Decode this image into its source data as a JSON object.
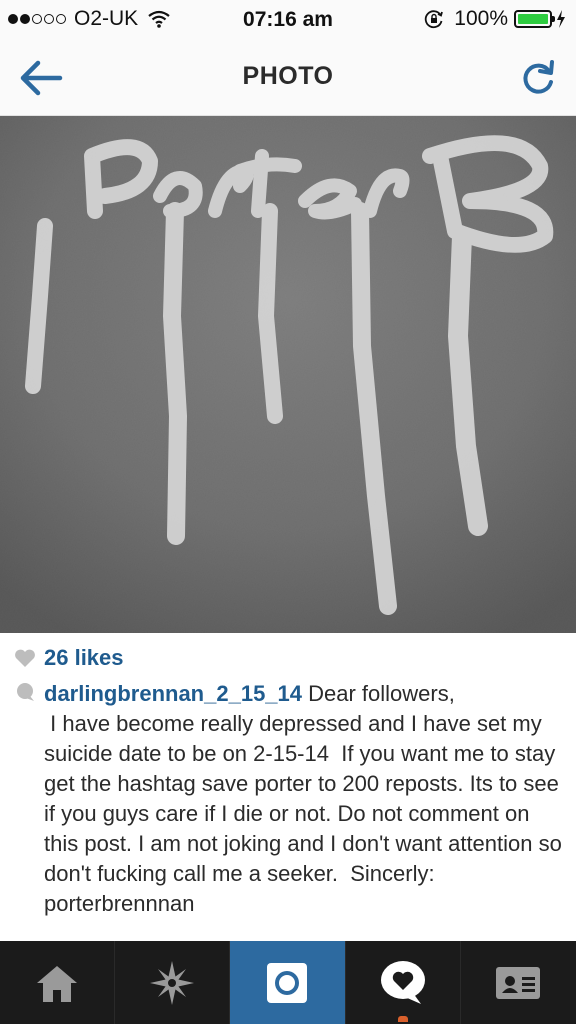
{
  "status_bar": {
    "carrier": "O2-UK",
    "time": "07:16 am",
    "battery_percent": "100%",
    "signal_bars_filled": 2,
    "signal_bars_total": 5,
    "icons": [
      "wifi-icon",
      "rotation-lock-icon",
      "battery-icon",
      "charging-bolt-icon"
    ]
  },
  "nav": {
    "title": "PHOTO",
    "back_icon": "back-arrow-icon",
    "refresh_icon": "refresh-icon"
  },
  "photo": {
    "graffiti_text": "PorterB"
  },
  "post": {
    "likes": "26 likes",
    "username": "darlingbrennan_2_15_14",
    "caption": " Dear followers,\n I have become really depressed and I have set my suicide date to be on 2-15-14  If you want me to stay get the hashtag save porter to 200 reposts. Its to see if you guys care if I die or not. Do not comment on this post. I am not joking and I don't want attention so don't fucking call me a seeker.  Sincerly: porterbrennnan"
  },
  "tab_bar": {
    "tabs": [
      "home",
      "explore",
      "camera",
      "activity",
      "profile"
    ],
    "active": "camera"
  },
  "colors": {
    "accent_blue": "#2d6aa0",
    "link_blue": "#1f5b8e",
    "tab_background": "#1b1b1b",
    "battery_green": "#2ecc40",
    "notification_orange": "#d9602c"
  }
}
